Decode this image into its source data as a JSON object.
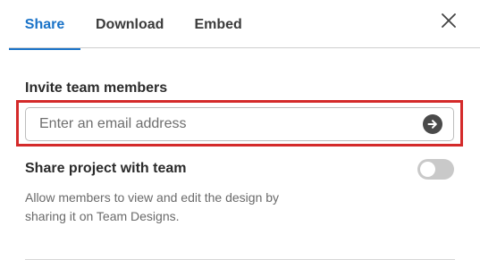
{
  "tabs": [
    {
      "label": "Share",
      "active": true
    },
    {
      "label": "Download",
      "active": false
    },
    {
      "label": "Embed",
      "active": false
    }
  ],
  "invite": {
    "title": "Invite team members",
    "email_placeholder": "Enter an email address",
    "email_value": "",
    "submit_icon": "arrow-right-circle-icon"
  },
  "share_project": {
    "label": "Share project with team",
    "enabled": false,
    "description": "Allow members to view and edit the design by sharing it on Team Designs."
  },
  "close_icon": "close-icon",
  "colors": {
    "accent": "#1a73c8",
    "highlight": "#d42a2a",
    "toggle_off": "#c9c9c9"
  }
}
